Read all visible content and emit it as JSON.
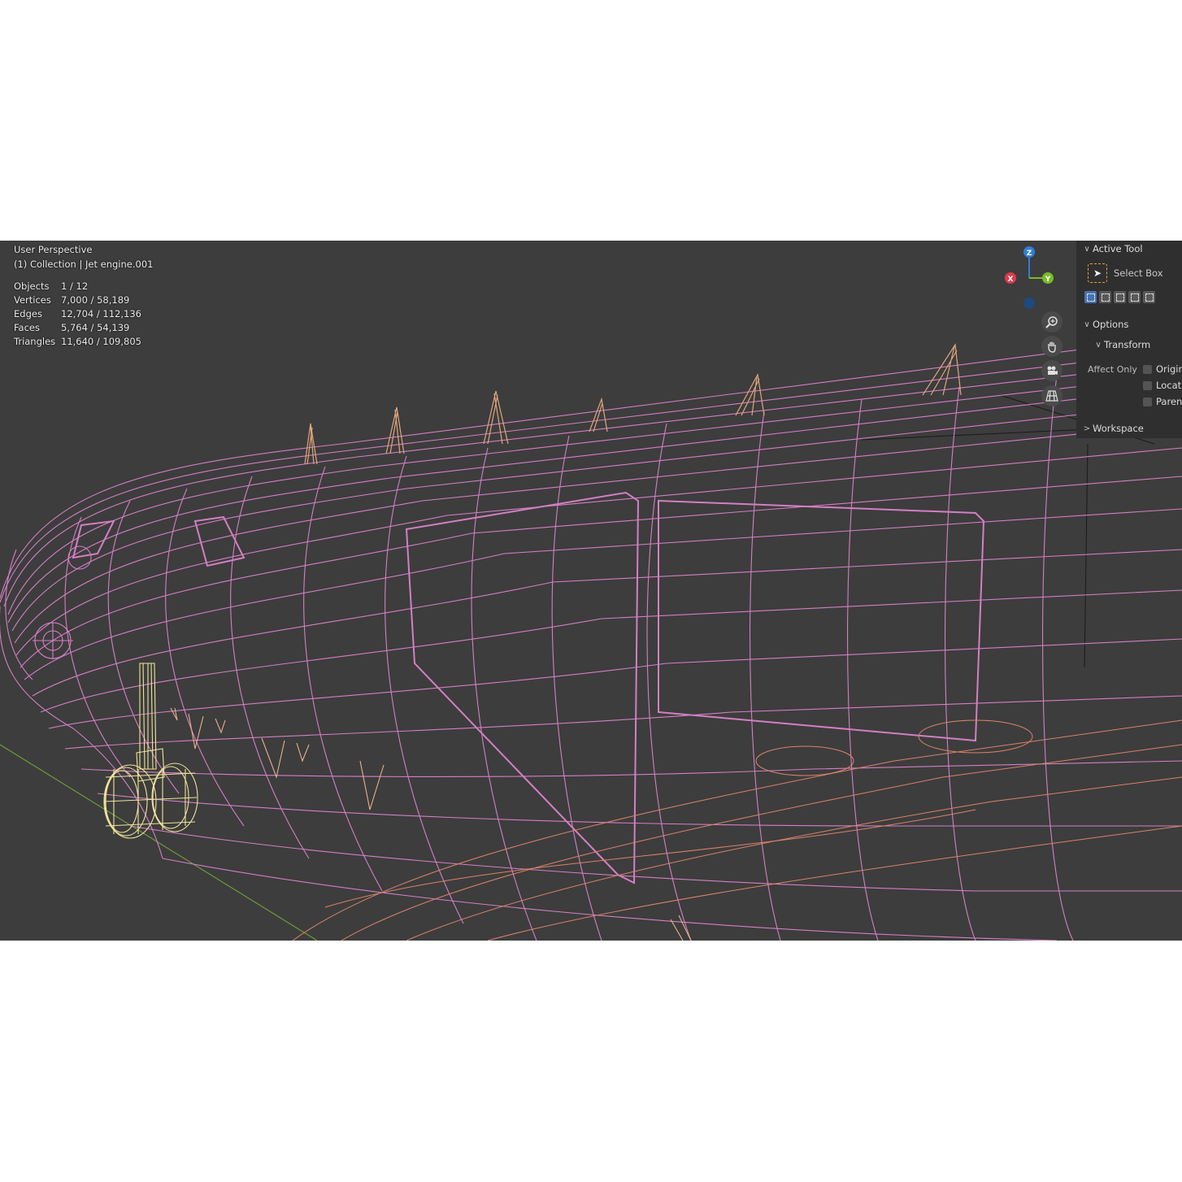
{
  "viewport": {
    "view_name": "User Perspective",
    "collection_line": "(1) Collection | Jet engine.001",
    "stats": [
      {
        "label": "Objects",
        "value": "1 / 12"
      },
      {
        "label": "Vertices",
        "value": "7,000 / 58,189"
      },
      {
        "label": "Edges",
        "value": "12,704 / 112,136"
      },
      {
        "label": "Faces",
        "value": "5,764 / 54,139"
      },
      {
        "label": "Triangles",
        "value": "11,640 / 109,805"
      }
    ]
  },
  "gizmo": {
    "z_label": "Z",
    "x_label": "X",
    "y_label": "Y",
    "colors": {
      "x": "#e03a4f",
      "y": "#7aba2a",
      "z": "#2f7fd6"
    }
  },
  "nav_icons": [
    "zoom-icon",
    "hand-pan-icon",
    "camera-icon",
    "grid-perspective-icon"
  ],
  "sidebar": {
    "active_tool_header": "Active Tool",
    "tool_name": "Select Box",
    "options_header": "Options",
    "transform_header": "Transform",
    "affect_only_label": "Affect Only",
    "affect_options": [
      "Origins",
      "Locations",
      "Parents"
    ],
    "workspace_header": "Workspace"
  },
  "colors": {
    "background": "#3d3d3d",
    "wire_body": "#d47fc4",
    "wire_selected": "#e9e28a",
    "wire_orange": "#d99a6a"
  }
}
